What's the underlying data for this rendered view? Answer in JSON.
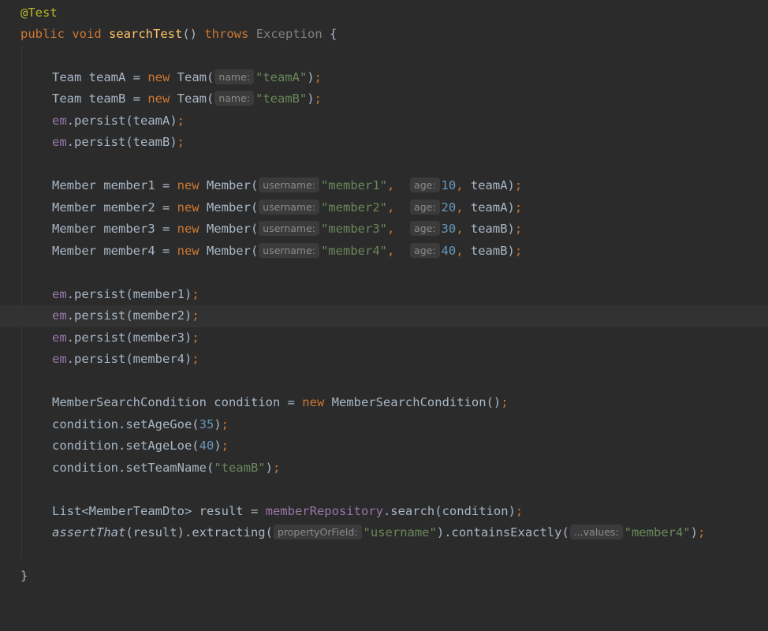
{
  "editor": {
    "annotation": "@Test",
    "signature": {
      "public": "public",
      "void": "void",
      "method": "searchTest",
      "parens": "() ",
      "throws": "throws",
      "exception": "Exception",
      "brace": " {"
    },
    "team_a": {
      "pre": "Team teamA = ",
      "new": "new",
      "cls": " Team(",
      "hint": "name:",
      "arg": "\"teamA\"",
      "close": ")",
      "semi": ";"
    },
    "team_b": {
      "pre": "Team teamB = ",
      "new": "new",
      "cls": " Team(",
      "hint": "name:",
      "arg": "\"teamB\"",
      "close": ")",
      "semi": ";"
    },
    "persist_team_a": {
      "em": "em",
      "call": ".persist(teamA)",
      "semi": ";"
    },
    "persist_team_b": {
      "em": "em",
      "call": ".persist(teamB)",
      "semi": ";"
    },
    "members": [
      {
        "pre": "Member member1 = ",
        "new": "new",
        "cls": " Member(",
        "hint_username": "username:",
        "username": "\"member1\"",
        "comma1": ",",
        "hint_age": "age:",
        "age": "10",
        "comma2": ",",
        "team": " teamA)",
        "semi": ";"
      },
      {
        "pre": "Member member2 = ",
        "new": "new",
        "cls": " Member(",
        "hint_username": "username:",
        "username": "\"member2\"",
        "comma1": ",",
        "hint_age": "age:",
        "age": "20",
        "comma2": ",",
        "team": " teamA)",
        "semi": ";"
      },
      {
        "pre": "Member member3 = ",
        "new": "new",
        "cls": " Member(",
        "hint_username": "username:",
        "username": "\"member3\"",
        "comma1": ",",
        "hint_age": "age:",
        "age": "30",
        "comma2": ",",
        "team": " teamB)",
        "semi": ";"
      },
      {
        "pre": "Member member4 = ",
        "new": "new",
        "cls": " Member(",
        "hint_username": "username:",
        "username": "\"member4\"",
        "comma1": ",",
        "hint_age": "age:",
        "age": "40",
        "comma2": ",",
        "team": " teamB)",
        "semi": ";"
      }
    ],
    "persist_members": [
      {
        "em": "em",
        "call": ".persist(member1)",
        "semi": ";"
      },
      {
        "em": "em",
        "call": ".persist(member2)",
        "semi": ";"
      },
      {
        "em": "em",
        "call": ".persist(member3)",
        "semi": ";"
      },
      {
        "em": "em",
        "call": ".persist(member4)",
        "semi": ";"
      }
    ],
    "condition_decl": {
      "pre": "MemberSearchCondition condition = ",
      "new": "new",
      "rest": " MemberSearchCondition()",
      "semi": ";"
    },
    "set_age_goe": {
      "pre": "condition.setAgeGoe(",
      "num": "35",
      "close": ")",
      "semi": ";"
    },
    "set_age_loe": {
      "pre": "condition.setAgeLoe(",
      "num": "40",
      "close": ")",
      "semi": ";"
    },
    "set_team_name": {
      "pre": "condition.setTeamName(",
      "str": "\"teamB\"",
      "close": ")",
      "semi": ";"
    },
    "result_decl": {
      "pre": "List<MemberTeamDto> result = ",
      "field": "memberRepository",
      "rest": ".search(condition)",
      "semi": ";"
    },
    "assert_line": {
      "fn": "assertThat",
      "p1": "(result).extracting(",
      "hint1": "propertyOrField:",
      "str1": "\"username\"",
      "p2": ").containsExactly(",
      "hint2": "...values:",
      "str2": "\"member4\"",
      "close": ")",
      "semi": ";"
    },
    "closing_brace": "}"
  },
  "colors": {
    "background": "#2b2b2b",
    "current_line": "#323232",
    "keyword": "#cc7832",
    "string": "#6a8759",
    "number": "#6897bb",
    "method": "#ffc66d",
    "annotation": "#bbb529",
    "field": "#9876aa"
  },
  "icons": {
    "gutter_marker": "lightbulb-icon"
  }
}
